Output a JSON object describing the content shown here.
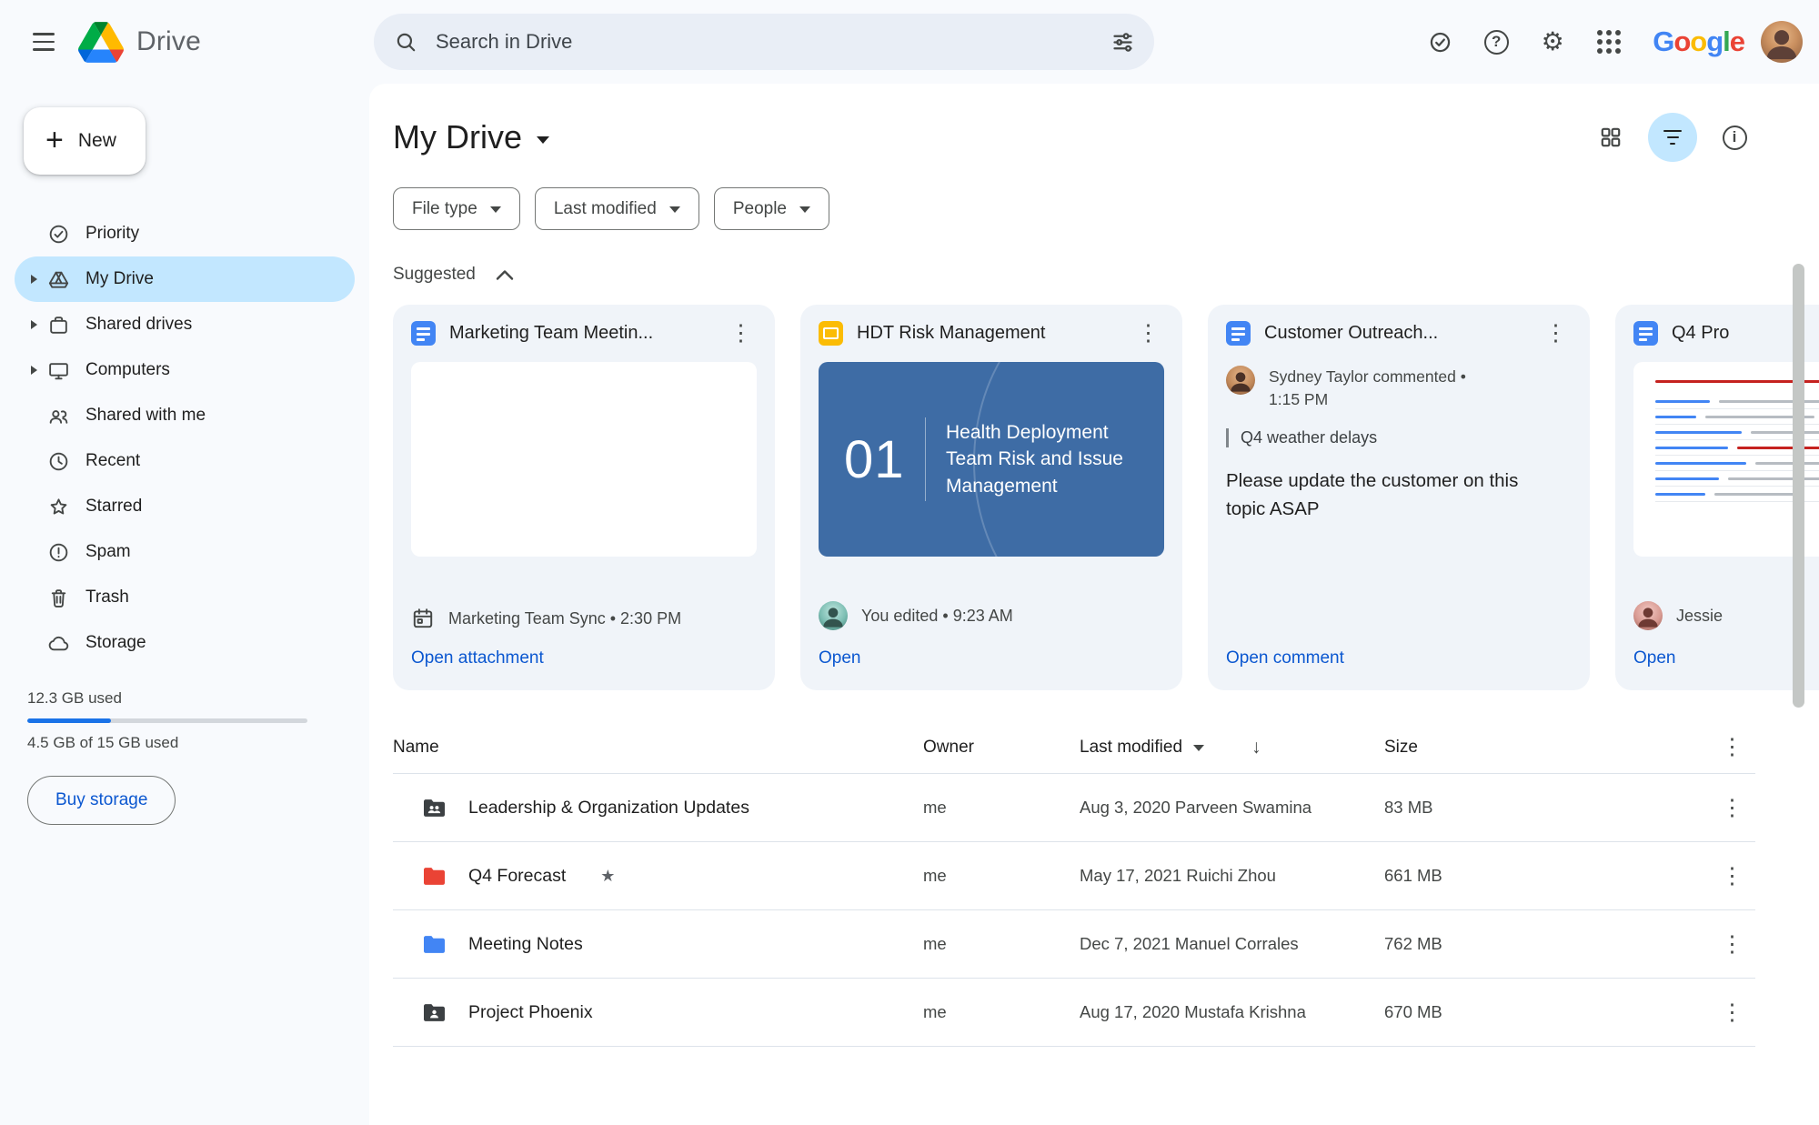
{
  "colors": {
    "chrome-bg": "#f8fafd",
    "panel-bg": "#ffffff",
    "card-bg": "#f0f4f9",
    "search-bg": "#e9eef6",
    "accent": "#0b57d0",
    "selected-pill": "#c2e7ff",
    "text-primary": "#1f1f1f",
    "text-secondary": "#444746",
    "divider": "#dde3ea",
    "slide-blue": "#3e6ca5",
    "docs-blue": "#4285f4",
    "slides-yellow": "#fbbc04",
    "folder-red": "#ea4335",
    "folder-blue": "#4285f4",
    "folder-dark": "#3c4043",
    "progress-fill": "#1a73e8"
  },
  "icons": {
    "kebab": "⋮",
    "plus": "+",
    "gear": "⚙",
    "help": "?",
    "info": "i",
    "star": "★",
    "sort_desc": "↓"
  },
  "topbar": {
    "app_name": "Drive",
    "search_placeholder": "Search in Drive",
    "google_letters": [
      "G",
      "o",
      "o",
      "g",
      "l",
      "e"
    ]
  },
  "sidebar": {
    "new_button_label": "New",
    "items": [
      {
        "label": "Priority"
      },
      {
        "label": "My Drive"
      },
      {
        "label": "Shared drives"
      },
      {
        "label": "Computers"
      },
      {
        "label": "Shared with me"
      },
      {
        "label": "Recent"
      },
      {
        "label": "Starred"
      },
      {
        "label": "Spam"
      },
      {
        "label": "Trash"
      },
      {
        "label": "Storage"
      }
    ],
    "storage": {
      "used_label": "12.3 GB used",
      "quota_label": "4.5 GB of 15 GB used",
      "buy_button_label": "Buy storage"
    }
  },
  "main": {
    "title": "My Drive",
    "filters": [
      {
        "label": "File type"
      },
      {
        "label": "Last modified"
      },
      {
        "label": "People"
      }
    ],
    "suggested_label": "Suggested",
    "cards": [
      {
        "title": "Marketing Team Meetin...",
        "meta": "Marketing Team Sync • 2:30 PM",
        "action": "Open attachment"
      },
      {
        "title": "HDT Risk Management",
        "slide_number": "01",
        "slide_title": "Health Deployment Team Risk and Issue Management",
        "meta": "You edited • 9:23 AM",
        "action": "Open"
      },
      {
        "title": "Customer Outreach...",
        "commenter": "Sydney Taylor commented • 1:15 PM",
        "quote": "Q4 weather delays",
        "body": "Please update the customer on this topic ASAP",
        "action": "Open comment"
      },
      {
        "title": "Q4 Pro",
        "meta": "Jessie",
        "action": "Open"
      }
    ],
    "table": {
      "columns": {
        "name": "Name",
        "owner": "Owner",
        "modified": "Last modified",
        "size": "Size"
      },
      "rows": [
        {
          "name": "Leadership & Organization Updates",
          "owner": "me",
          "modified": "Aug 3, 2020 Parveen Swamina",
          "size": "83 MB"
        },
        {
          "name": "Q4 Forecast",
          "owner": "me",
          "modified": "May 17, 2021 Ruichi Zhou",
          "size": "661 MB"
        },
        {
          "name": "Meeting Notes",
          "owner": "me",
          "modified": "Dec 7, 2021 Manuel Corrales",
          "size": "762 MB"
        },
        {
          "name": "Project Phoenix",
          "owner": "me",
          "modified": "Aug 17, 2020 Mustafa Krishna",
          "size": "670 MB"
        }
      ]
    }
  }
}
